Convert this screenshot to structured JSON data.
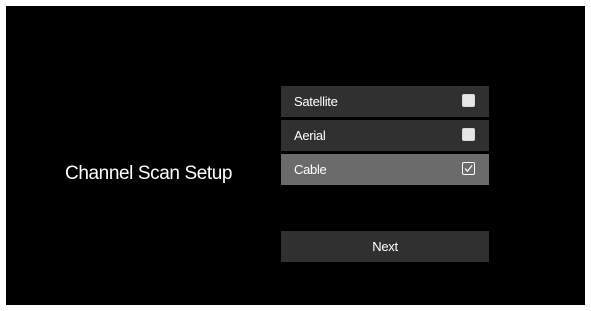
{
  "page": {
    "title": "Channel Scan Setup"
  },
  "options": [
    {
      "label": "Satellite",
      "checked": false
    },
    {
      "label": "Aerial",
      "checked": false
    },
    {
      "label": "Cable",
      "checked": true
    }
  ],
  "actions": {
    "next_label": "Next"
  },
  "icons": {
    "unchecked": "checkbox-empty-icon",
    "checked": "checkbox-checked-icon"
  },
  "colors": {
    "background": "#000000",
    "option_bg": "#303030",
    "option_selected_bg": "#6b6b6b",
    "text": "#ffffff"
  }
}
